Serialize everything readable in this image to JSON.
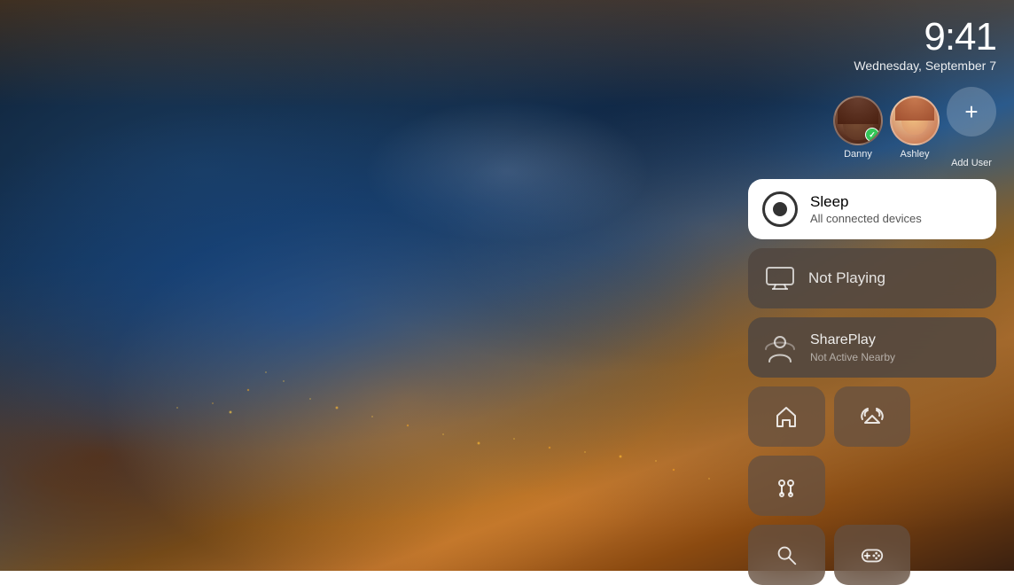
{
  "time": {
    "clock": "9:41",
    "date": "Wednesday, September 7"
  },
  "users": [
    {
      "id": "danny",
      "name": "Danny",
      "active": true
    },
    {
      "id": "ashley",
      "name": "Ashley",
      "active": false
    }
  ],
  "add_user_label": "+",
  "add_user_text": "Add User",
  "sleep_card": {
    "title": "Sleep",
    "subtitle": "All connected devices"
  },
  "not_playing_card": {
    "label": "Not Playing"
  },
  "shareplay_card": {
    "title": "SharePlay",
    "subtitle": "Not Active Nearby"
  },
  "icon_buttons": [
    {
      "id": "home",
      "icon": "home-icon"
    },
    {
      "id": "airplay",
      "icon": "airplay-icon"
    },
    {
      "id": "airpods",
      "icon": "airpods-icon"
    },
    {
      "id": "search",
      "icon": "search-icon"
    },
    {
      "id": "gamepad",
      "icon": "gamepad-icon"
    }
  ]
}
